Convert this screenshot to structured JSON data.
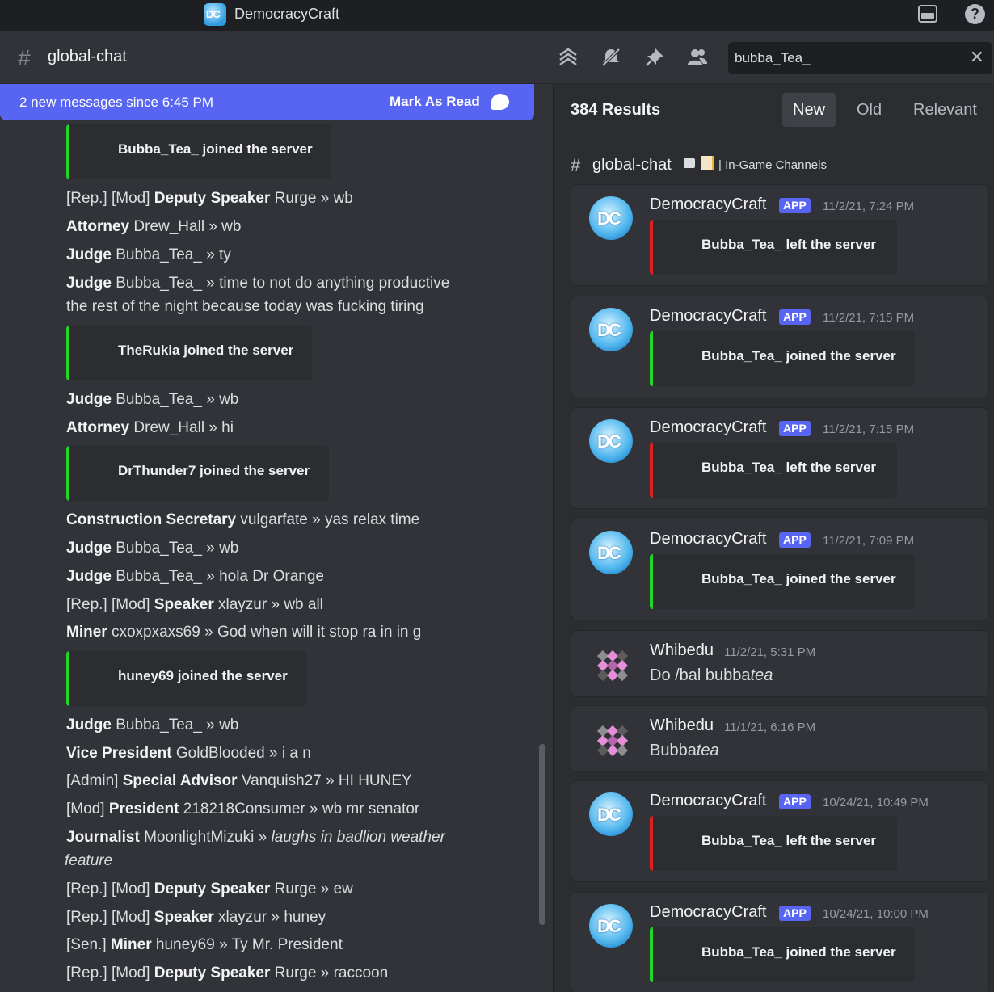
{
  "app": {
    "title": "DemocracyCraft",
    "logo_text": "DC"
  },
  "header": {
    "channel": "global-chat",
    "search_value": "bubba_Tea_"
  },
  "left": {
    "new_bar": {
      "text": "2 new messages since 6:45 PM",
      "mark_label": "Mark As Read"
    },
    "messages": [
      {
        "type": "embed",
        "color": "green",
        "text": "Bubba_Tea_ joined the server"
      },
      {
        "prefix": "[Rep.]  [Mod] ",
        "role": "Deputy Speaker",
        "user": " Rurge",
        "sep": " » ",
        "text": " wb"
      },
      {
        "prefix": "",
        "role": "Attorney",
        "user": " Drew_Hall",
        "sep": " » ",
        "text": " wb"
      },
      {
        "prefix": "",
        "role": "Judge",
        "user": " Bubba_Tea_",
        "sep": " » ",
        "text": " ty"
      },
      {
        "prefix": "",
        "role": "Judge",
        "user": " Bubba_Tea_",
        "sep": " » ",
        "text": " time to not do anything productive"
      },
      {
        "prefix": "",
        "role": "",
        "user": "",
        "sep": "",
        "text": "the rest of the night because today was fucking tiring"
      },
      {
        "type": "embed",
        "color": "green",
        "text": "TheRukia joined the server"
      },
      {
        "prefix": "",
        "role": "Judge",
        "user": " Bubba_Tea_",
        "sep": " » ",
        "text": " wb"
      },
      {
        "prefix": "",
        "role": "Attorney",
        "user": " Drew_Hall",
        "sep": " » ",
        "text": " hi"
      },
      {
        "type": "embed",
        "color": "green",
        "text": "DrThunder7 joined the server"
      },
      {
        "prefix": "",
        "role": "Construction Secretary",
        "user": " vulgarfate",
        "sep": " » ",
        "text": " yas relax time"
      },
      {
        "prefix": "",
        "role": "Judge",
        "user": " Bubba_Tea_",
        "sep": " » ",
        "text": " wb"
      },
      {
        "prefix": "",
        "role": "Judge",
        "user": " Bubba_Tea_",
        "sep": " » ",
        "text": " hola Dr Orange"
      },
      {
        "prefix": "[Rep.]  [Mod] ",
        "role": "Speaker",
        "user": " xlayzur",
        "sep": " » ",
        "text": " wb all"
      },
      {
        "prefix": "",
        "role": "Miner",
        "user": " cxoxpxaxs69",
        "sep": " » ",
        "text": " God when will it stop ra in in g"
      },
      {
        "type": "embed",
        "color": "green",
        "text": "huney69 joined the server"
      },
      {
        "prefix": "",
        "role": "Judge",
        "user": " Bubba_Tea_",
        "sep": " » ",
        "text": " wb"
      },
      {
        "prefix": "",
        "role": "Vice President",
        "user": " GoldBlooded",
        "sep": " » ",
        "text": " i a n"
      },
      {
        "prefix": "[Admin] ",
        "role": "Special Advisor",
        "user": " Vanquish27",
        "sep": " » ",
        "text": " HI HUNEY"
      },
      {
        "prefix": "[Mod] ",
        "role": "President",
        "user": " 218218Consumer",
        "sep": " » ",
        "text": " wb mr senator"
      },
      {
        "prefix": "",
        "role": "Journalist",
        "user": " MoonlightMizuki",
        "sep": " » ",
        "text": " laughs in badlion weather"
      },
      {
        "prefix": "",
        "role": "",
        "user": "",
        "sep": "",
        "text": "feature"
      },
      {
        "prefix": "[Rep.]  [Mod] ",
        "role": "Deputy Speaker",
        "user": " Rurge",
        "sep": " » ",
        "text": " ew"
      },
      {
        "prefix": "[Rep.]  [Mod] ",
        "role": "Speaker",
        "user": " xlayzur",
        "sep": " » ",
        "text": " huney"
      },
      {
        "prefix": "[Sen.]  ",
        "role": "Miner",
        "user": " huney69",
        "sep": " » ",
        "text": " Ty Mr. President"
      },
      {
        "prefix": "[Rep.]  [Mod] ",
        "role": "Deputy Speaker",
        "user": " Rurge",
        "sep": " » ",
        "text": " raccoon"
      }
    ]
  },
  "right": {
    "results": "384 Results",
    "sort": {
      "new": "New",
      "old": "Old",
      "relevant": "Relevant",
      "active": "New"
    },
    "channel": {
      "name": "global-chat",
      "category": "| In-Game Channels"
    },
    "cards": [
      {
        "user": "DemocracyCraft",
        "tag": "APP",
        "time": "11/2/21, 7:24 PM",
        "embed": "Bubba_Tea_ left the server",
        "color": "red"
      },
      {
        "user": "DemocracyCraft",
        "tag": "APP",
        "time": "11/2/21, 7:15 PM",
        "embed": "Bubba_Tea_ joined the server",
        "color": "green"
      },
      {
        "user": "DemocracyCraft",
        "tag": "APP",
        "time": "11/2/21, 7:15 PM",
        "embed": "Bubba_Tea_ left the server",
        "color": "red"
      },
      {
        "user": "DemocracyCraft",
        "tag": "APP",
        "time": "11/2/21, 7:09 PM",
        "embed": "Bubba_Tea_ joined the server",
        "color": "green"
      },
      {
        "user": "Whibedu",
        "time": "11/2/21, 5:31 PM",
        "text": "Do /bal bubba",
        "text_italic": "tea"
      },
      {
        "user": "Whibedu",
        "time": "11/1/21, 6:16 PM",
        "text": "Bubba",
        "text_italic": "tea"
      },
      {
        "user": "DemocracyCraft",
        "tag": "APP",
        "time": "10/24/21, 10:49 PM",
        "embed": "Bubba_Tea_ left the server",
        "color": "red"
      },
      {
        "user": "DemocracyCraft",
        "tag": "APP",
        "time": "10/24/21, 10:00 PM",
        "embed": "Bubba_Tea_ joined the server",
        "color": "green"
      }
    ]
  },
  "icons": [
    "democracycraft-logo-icon",
    "inbox-icon",
    "help-icon",
    "hash-icon",
    "threads-icon",
    "mute-icon",
    "pin-icon",
    "members-icon",
    "close-icon",
    "mark-read-icon",
    "folder-icon",
    "memo-icon"
  ]
}
